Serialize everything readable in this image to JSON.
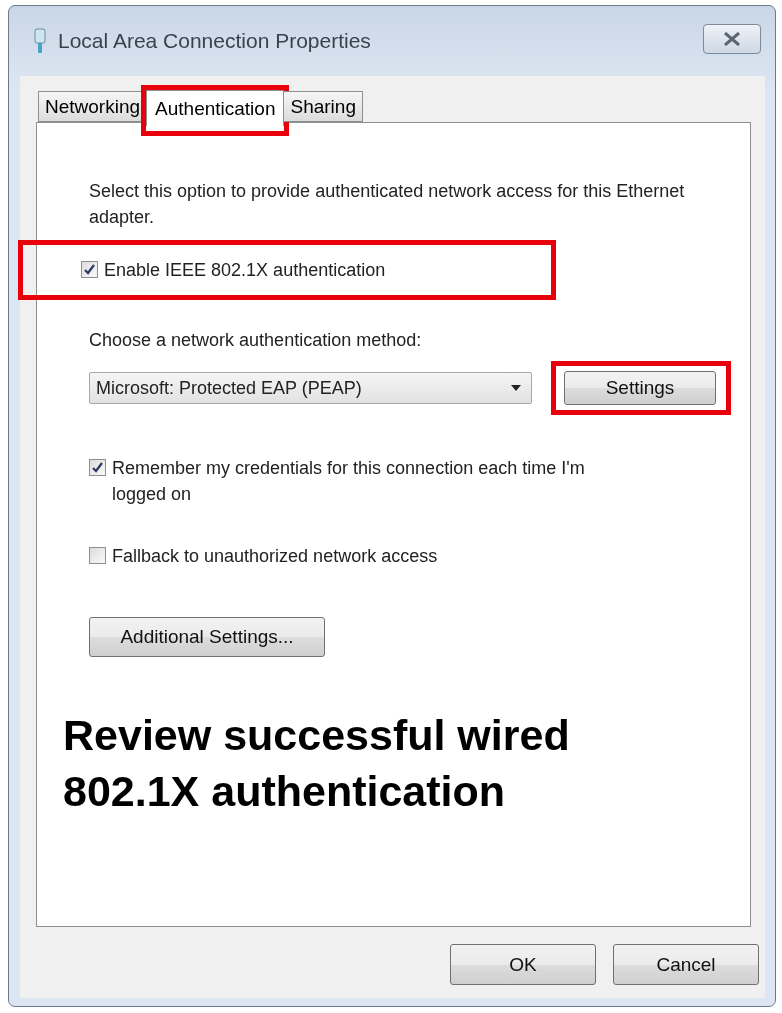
{
  "window": {
    "title": "Local Area Connection Properties"
  },
  "tabs": [
    {
      "label": "Networking",
      "selected": false,
      "highlighted": false
    },
    {
      "label": "Authentication",
      "selected": true,
      "highlighted": true
    },
    {
      "label": "Sharing",
      "selected": false,
      "highlighted": false
    }
  ],
  "intro": "Select this option to provide authenticated network access for this Ethernet adapter.",
  "enable_option": {
    "label": "Enable IEEE 802.1X authentication",
    "checked": true,
    "highlighted": true
  },
  "method": {
    "label": "Choose a network authentication method:",
    "value": "Microsoft: Protected EAP (PEAP)"
  },
  "settings_button": {
    "label": "Settings",
    "highlighted": true
  },
  "options": [
    {
      "label": "Remember my credentials for this connection each time I'm logged on",
      "checked": true
    },
    {
      "label": "Fallback to unauthorized network access",
      "checked": false
    }
  ],
  "additional_button": "Additional Settings...",
  "caption": "Review successful wired 802.1X authentication",
  "buttons": [
    "OK",
    "Cancel"
  ]
}
